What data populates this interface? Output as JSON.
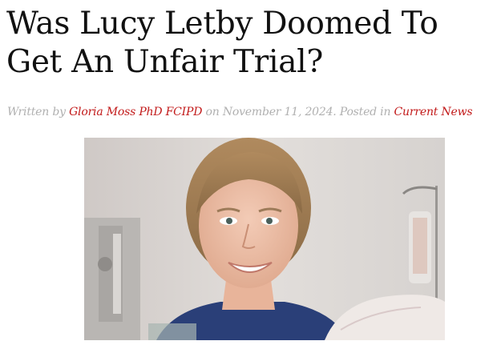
{
  "article": {
    "title": "Was Lucy Letby Doomed To Get An Unfair Trial?",
    "meta": {
      "written_by_prefix": "Written by",
      "author": "Gloria Moss PhD FCIPD",
      "on_text": "on",
      "date": "November 11, 2024",
      "posted_in_text": ". Posted in",
      "category": "Current News"
    },
    "image": {
      "alt": "Photo of a smiling woman in a hospital room"
    }
  },
  "colors": {
    "link": "#c21a1a",
    "meta_text": "#b0b0b0",
    "title_text": "#111111"
  }
}
